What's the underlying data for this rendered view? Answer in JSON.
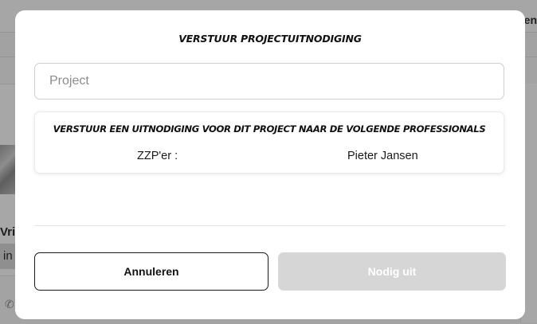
{
  "background": {
    "topbar_text": "en",
    "card_name": "Vrie",
    "card_chip": "in"
  },
  "modal": {
    "title": "VERSTUUR PROJECTUITNODIGING",
    "project_input": {
      "placeholder": "Project",
      "value": ""
    },
    "invite_box": {
      "heading": "VERSTUUR EEN UITNODIGING VOOR DIT PROJECT NAAR DE VOLGENDE PROFESSIONALS",
      "role_label": "ZZP'er :",
      "professional_name": "Pieter Jansen"
    },
    "buttons": {
      "cancel_label": "Annuleren",
      "invite_label": "Nodig uit",
      "invite_disabled": true
    }
  },
  "colors": {
    "overlay": "#a3a3a3",
    "modal_bg": "#ffffff",
    "disabled_button": "#d6d6d6",
    "border_dark": "#1a1a1a"
  },
  "icons": {
    "background_phone": "phone-icon"
  }
}
